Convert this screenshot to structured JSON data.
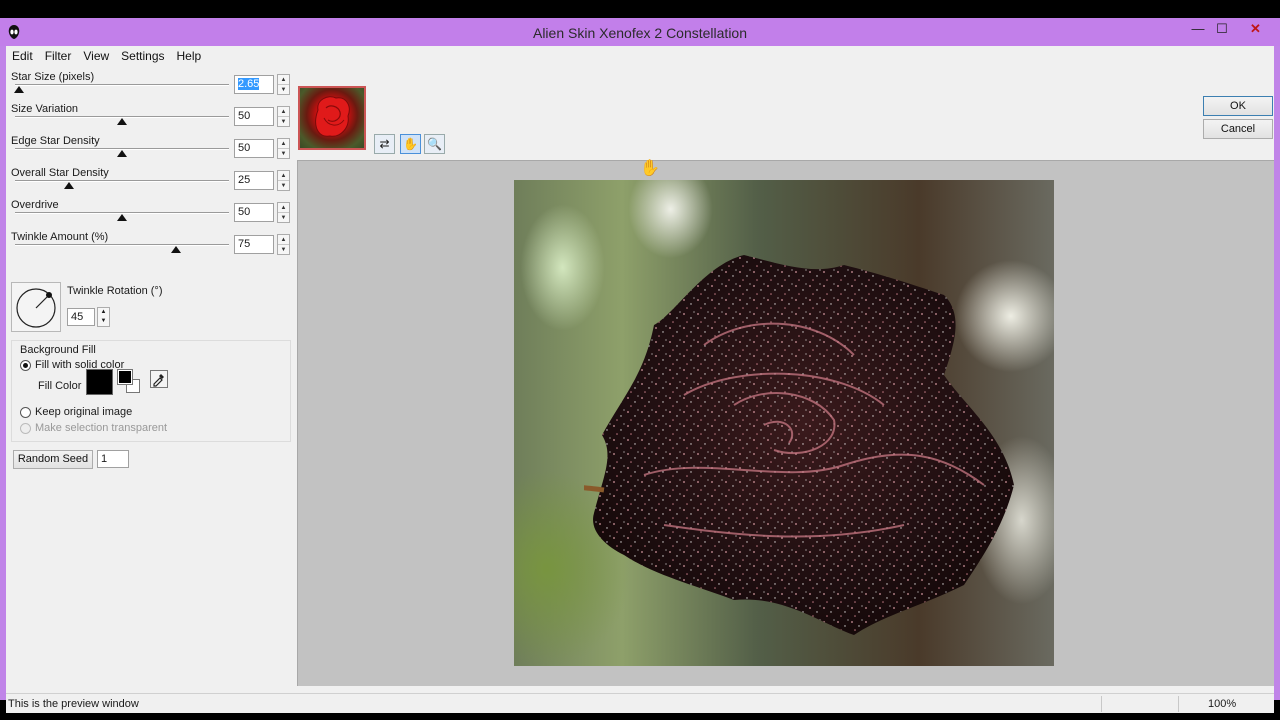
{
  "window": {
    "title": "Alien Skin Xenofex 2 Constellation",
    "minimize": "—",
    "maximize": "☐",
    "close": "✕"
  },
  "menu": [
    "Edit",
    "Filter",
    "View",
    "Settings",
    "Help"
  ],
  "sliders": [
    {
      "label": "Star Size (pixels)",
      "value": "2.65",
      "level": 0.02,
      "selected": true
    },
    {
      "label": "Size Variation",
      "value": "50",
      "level": 0.5
    },
    {
      "label": "Edge Star Density",
      "value": "50",
      "level": 0.5
    },
    {
      "label": "Overall Star Density",
      "value": "25",
      "level": 0.25
    },
    {
      "label": "Overdrive",
      "value": "50",
      "level": 0.5
    },
    {
      "label": "Twinkle Amount (%)",
      "value": "75",
      "level": 0.75
    }
  ],
  "twinkle_rotation": {
    "label": "Twinkle Rotation (°)",
    "value": "45"
  },
  "background_fill": {
    "title": "Background Fill",
    "fill_solid": "Fill with solid color",
    "fill_color_label": "Fill Color",
    "fill_color": "#000000",
    "keep_original": "Keep original image",
    "make_transparent": "Make selection transparent"
  },
  "random_seed": {
    "button": "Random Seed",
    "value": "1"
  },
  "tools": [
    "preview-compare-icon",
    "hand-icon",
    "zoom-icon"
  ],
  "buttons": {
    "ok": "OK",
    "cancel": "Cancel"
  },
  "status": {
    "text": "This is the preview window",
    "zoom": "100%"
  }
}
